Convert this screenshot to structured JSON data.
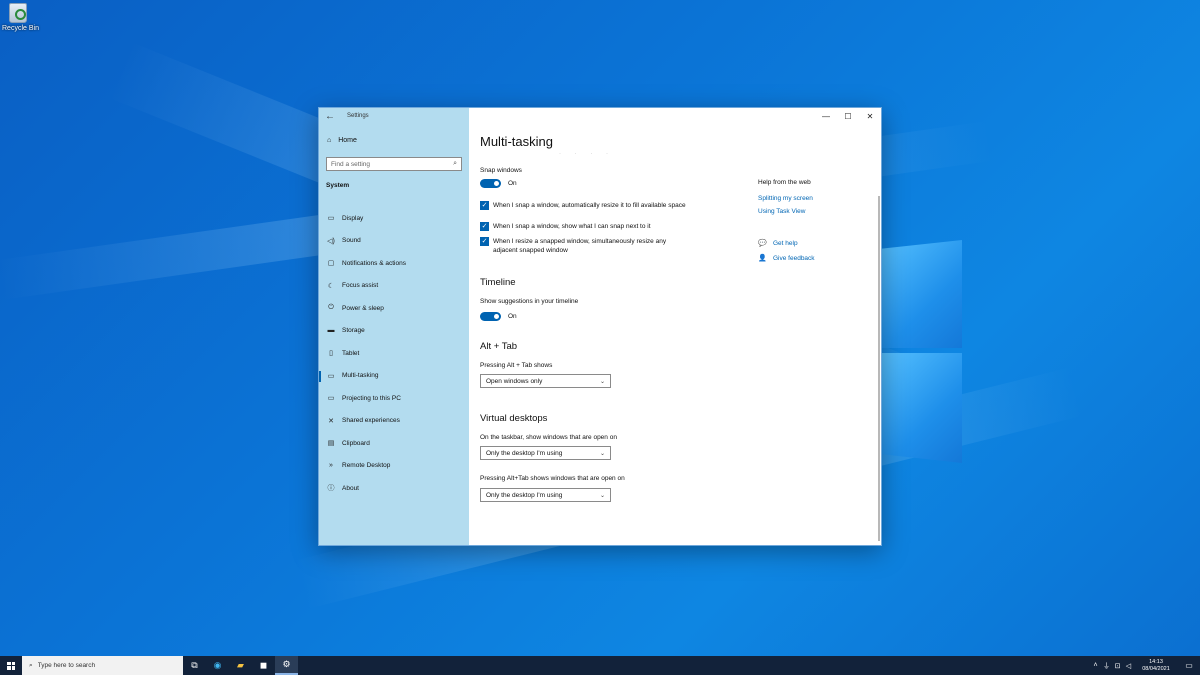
{
  "desktop": {
    "icons": [
      {
        "label": "Recycle Bin"
      }
    ]
  },
  "window": {
    "title": "Settings",
    "controls": {
      "minimize": "—",
      "maximize": "☐",
      "close": "✕"
    }
  },
  "sidebar": {
    "home_label": "Home",
    "search_placeholder": "Find a setting",
    "section": "System",
    "items": [
      {
        "label": "Display",
        "icon": "display-icon",
        "glyph": "▭"
      },
      {
        "label": "Sound",
        "icon": "speaker-icon",
        "glyph": "🔈"
      },
      {
        "label": "Notifications & actions",
        "icon": "notifications-icon",
        "glyph": "▢"
      },
      {
        "label": "Focus assist",
        "icon": "moon-icon",
        "glyph": "☾"
      },
      {
        "label": "Power & sleep",
        "icon": "power-icon",
        "glyph": "⏻"
      },
      {
        "label": "Storage",
        "icon": "storage-icon",
        "glyph": "▬"
      },
      {
        "label": "Tablet",
        "icon": "tablet-icon",
        "glyph": "▯"
      },
      {
        "label": "Multi-tasking",
        "icon": "multitasking-icon",
        "glyph": "▭",
        "active": true
      },
      {
        "label": "Projecting to this PC",
        "icon": "projecting-icon",
        "glyph": "▭"
      },
      {
        "label": "Shared experiences",
        "icon": "shared-experiences-icon",
        "glyph": "✕"
      },
      {
        "label": "Clipboard",
        "icon": "clipboard-icon",
        "glyph": "▤"
      },
      {
        "label": "Remote Desktop",
        "icon": "remote-desktop-icon",
        "glyph": "»"
      },
      {
        "label": "About",
        "icon": "info-icon",
        "glyph": "ⓘ"
      }
    ]
  },
  "main": {
    "title": "Multi-tasking",
    "snap": {
      "label": "Snap windows",
      "toggle_state": "On",
      "options": [
        {
          "label": "When I snap a window, automatically resize it to fill available space",
          "checked": true
        },
        {
          "label": "When I snap a window, show what I can snap next to it",
          "checked": true
        },
        {
          "label": "When I resize a snapped window, simultaneously resize any adjacent snapped window",
          "checked": true
        }
      ]
    },
    "timeline": {
      "heading": "Timeline",
      "label": "Show suggestions in your timeline",
      "toggle_state": "On"
    },
    "alt_tab": {
      "heading": "Alt + Tab",
      "label": "Pressing Alt + Tab shows",
      "value": "Open windows only"
    },
    "virtual_desktops": {
      "heading": "Virtual desktops",
      "taskbar_label": "On the taskbar, show windows that are open on",
      "taskbar_value": "Only the desktop I'm using",
      "alttab_label": "Pressing Alt+Tab shows windows that are open on",
      "alttab_value": "Only the desktop I'm using"
    },
    "help": {
      "title": "Help from the web",
      "links": [
        "Splitting my screen",
        "Using Task View"
      ],
      "get_help": "Get help",
      "give_feedback": "Give feedback"
    }
  },
  "taskbar": {
    "search_placeholder": "Type here to search",
    "apps": [
      {
        "icon": "task-view-icon",
        "glyph": "⧉"
      },
      {
        "icon": "edge-icon",
        "glyph": "◉"
      },
      {
        "icon": "file-explorer-icon",
        "glyph": "▰"
      },
      {
        "icon": "store-icon",
        "glyph": "◼"
      },
      {
        "icon": "settings-icon",
        "glyph": "⚙",
        "active": true
      }
    ],
    "clock": {
      "time": "14:13",
      "date": "08/04/2021"
    }
  },
  "colors": {
    "accent": "#0063b1",
    "sidebar_bg": "#b3dcef",
    "link": "#0066b4",
    "taskbar": "#12223a"
  }
}
